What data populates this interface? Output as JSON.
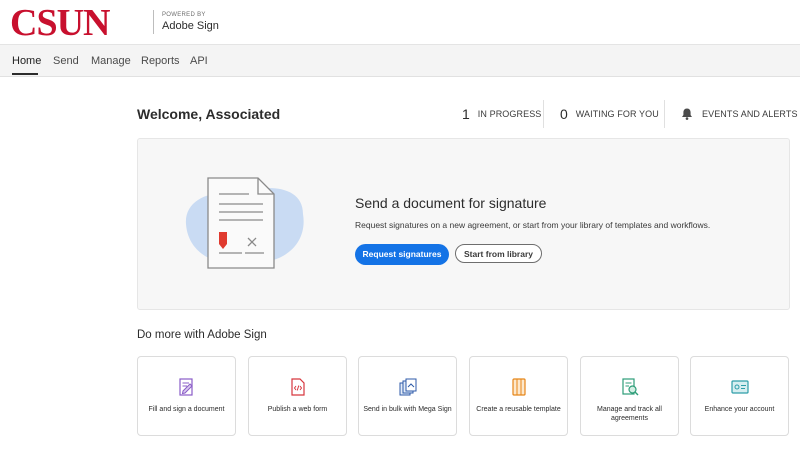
{
  "header": {
    "logo_text": "CSUN",
    "powered_by": "POWERED BY",
    "product": "Adobe Sign",
    "brand_color": "#c8102e"
  },
  "nav": {
    "items": [
      {
        "label": "Home",
        "active": true
      },
      {
        "label": "Send",
        "active": false
      },
      {
        "label": "Manage",
        "active": false
      },
      {
        "label": "Reports",
        "active": false
      },
      {
        "label": "API",
        "active": false
      }
    ]
  },
  "welcome": {
    "title": "Welcome, Associated",
    "stats": {
      "in_progress": {
        "count": "1",
        "label": "IN PROGRESS"
      },
      "waiting": {
        "count": "0",
        "label": "WAITING FOR YOU"
      },
      "events": {
        "icon": "bell-icon",
        "label": "EVENTS AND ALERTS"
      }
    }
  },
  "send_card": {
    "title": "Send a document for signature",
    "subtitle": "Request signatures on a new agreement, or start from your library of templates and workflows.",
    "primary_button": "Request signatures",
    "secondary_button": "Start from library",
    "accent_color": "#1473e6"
  },
  "do_more": {
    "title": "Do more with Adobe Sign",
    "tiles": [
      {
        "label": "Fill and sign a document",
        "icon": "fill-sign-icon",
        "color": "#8a5cc7"
      },
      {
        "label": "Publish a web form",
        "icon": "web-form-icon",
        "color": "#d7373f"
      },
      {
        "label": "Send in bulk with Mega Sign",
        "icon": "mega-sign-icon",
        "color": "#2d5aa8"
      },
      {
        "label": "Create a reusable template",
        "icon": "template-icon",
        "color": "#e68619"
      },
      {
        "label": "Manage and track all agreements",
        "icon": "track-agreements-icon",
        "color": "#2d9d78"
      },
      {
        "label": "Enhance your account",
        "icon": "enhance-account-icon",
        "color": "#2d9da8"
      }
    ]
  }
}
